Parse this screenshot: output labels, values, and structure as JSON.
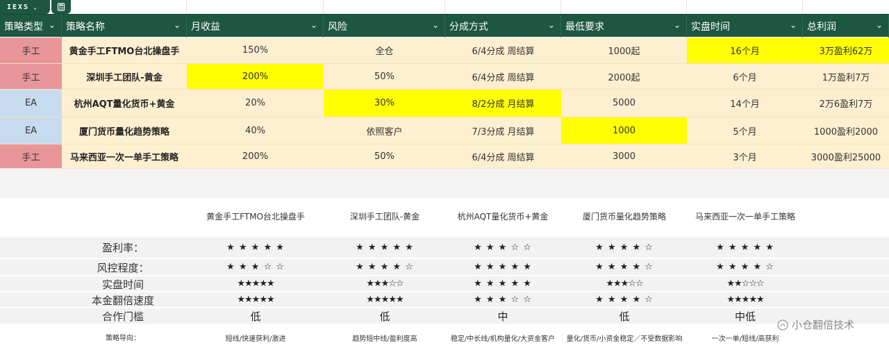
{
  "toolbar": {
    "tab_label": "IEXS",
    "tab_chevron": "⌄",
    "calc_icon": "calculator-icon"
  },
  "table": {
    "headers": [
      "策略类型",
      "策略名称",
      "月收益",
      "风险",
      "分成方式",
      "最低要求",
      "实盘时间",
      "总利润"
    ],
    "rows": [
      {
        "type": "手工",
        "name": "黄金手工FTMO台北操盘手",
        "monthly": "150%",
        "risk": "全仓",
        "split": "6/4分成 周结算",
        "min": "1000起",
        "live": "16个月",
        "profit": "3万盈利62万"
      },
      {
        "type": "手工",
        "name": "深圳手工团队-黄金",
        "monthly": "200%",
        "risk": "50%",
        "split": "6/4分成 周结算",
        "min": "2000起",
        "live": "6个月",
        "profit": "1万盈利7万"
      },
      {
        "type": "EA",
        "name": "杭州AQT量化货币+黄金",
        "monthly": "20%",
        "risk": "30%",
        "split": "8/2分成 月结算",
        "min": "5000",
        "live": "14个月",
        "profit": "2万6盈利7万"
      },
      {
        "type": "EA",
        "name": "厦门货币量化趋势策略",
        "monthly": "40%",
        "risk": "依照客户",
        "split": "7/3分成 月结算",
        "min": "1000",
        "live": "5个月",
        "profit": "1000盈利2000"
      },
      {
        "type": "手工",
        "name": "马来西亚一次一单手工策略",
        "monthly": "200%",
        "risk": "50%",
        "split": "6/4分成 周结算",
        "min": "3000",
        "live": "3个月",
        "profit": "3000盈利25000"
      }
    ],
    "colors": {
      "header_bg": "#1e5741",
      "manual": "#e8969a",
      "ea": "#c7dbef",
      "body": "#fdefd0",
      "highlight": "#ffff00"
    }
  },
  "comparison": {
    "strategies": [
      "黄金手工FTMO台北操盘手",
      "深圳手工团队-黄金",
      "杭州AQT量化货币+黄金",
      "厦门货币量化趋势策略",
      "马来西亚一次一单手工策略"
    ],
    "rows": [
      {
        "label": "盈利率：",
        "values": [
          "★ ★ ★ ★ ★",
          "★ ★ ★ ★ ★",
          "★ ★ ★ ☆ ☆",
          "★ ★ ★ ★ ☆",
          "★ ★ ★ ★ ★"
        ]
      },
      {
        "label": "风控程度：",
        "values": [
          "★ ★ ★ ☆ ☆",
          "★ ★ ★ ★ ☆",
          "★ ★ ★ ★ ★",
          "★ ★ ★ ★ ☆",
          "★ ★ ★ ★ ☆"
        ]
      },
      {
        "label": "实盘时间",
        "values": [
          "★★★★★",
          "★★★☆☆",
          "★ ★ ★ ★ ★",
          "★★★☆☆",
          "★★☆☆☆"
        ]
      },
      {
        "label": "本金翻倍速度",
        "values": [
          "★★★★★",
          "★★★★★",
          "★ ★ ★ ☆ ☆",
          "★ ★ ★ ★ ☆",
          "★★★★★"
        ]
      },
      {
        "label": "合作门槛",
        "values": [
          "低",
          "低",
          "中",
          "低",
          "中低"
        ]
      }
    ],
    "guide_label": "策略导向：",
    "guides": [
      "短线/快速获利/激进",
      "趋势短中线/盈利度高",
      "稳定/中长线/机构量化/大资金客户",
      "量化/货币/小资金稳定／不受数据影响",
      "一次一单/短线/高获利"
    ]
  },
  "watermark": {
    "text": "小仓翻倍技术"
  }
}
